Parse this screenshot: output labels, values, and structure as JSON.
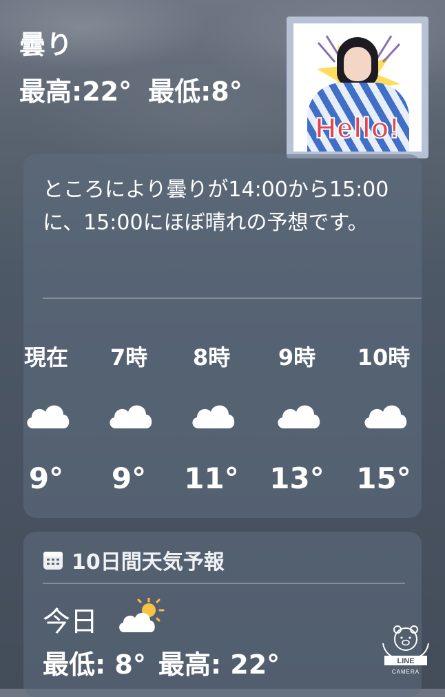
{
  "header": {
    "condition": "曇り",
    "high": "最高:22°",
    "low": "最低:8°"
  },
  "sticker": {
    "text": "Hello!"
  },
  "summary": {
    "text": "ところにより曇りが14:00から15:00に、15:00にほぼ晴れの予想です。"
  },
  "hourly": [
    {
      "label": "現在",
      "icon": "cloud-icon",
      "temp": "9°"
    },
    {
      "label": "7時",
      "icon": "cloud-icon",
      "temp": "9°"
    },
    {
      "label": "8時",
      "icon": "cloud-icon",
      "temp": "11°"
    },
    {
      "label": "9時",
      "icon": "cloud-icon",
      "temp": "13°"
    },
    {
      "label": "10時",
      "icon": "cloud-icon",
      "temp": "15°"
    }
  ],
  "forecast": {
    "title": "10日間天気予報",
    "day": "今日",
    "icon": "partly-sunny-icon",
    "low": "最低: 8°",
    "high": "最高: 22°"
  },
  "watermark": {
    "line1": "LINE",
    "line2": "CAMERA"
  },
  "colors": {
    "sun": "#f6c344",
    "hello_red": "#e3434a",
    "kimono_blue": "#3f6fc7"
  }
}
